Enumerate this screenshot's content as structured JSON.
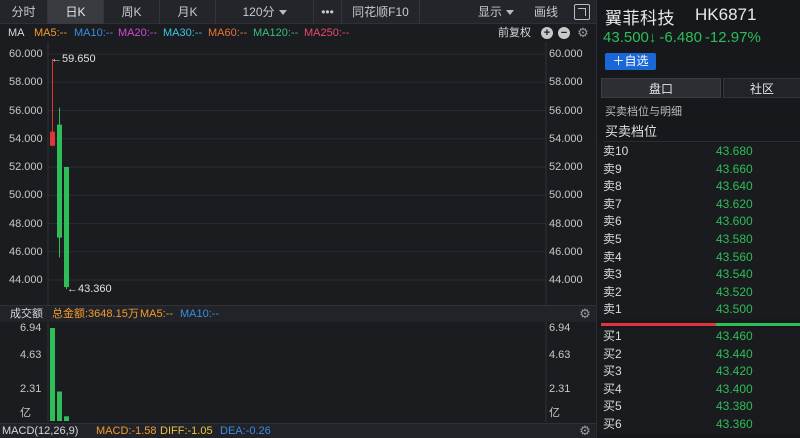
{
  "toolbar": {
    "tabs": [
      {
        "label": "分时"
      },
      {
        "label": "日K"
      },
      {
        "label": "周K"
      },
      {
        "label": "月K"
      },
      {
        "label": "120分"
      }
    ],
    "more_label": "•••",
    "f10_label": "同花顺F10",
    "display_label": "显示",
    "draw_label": "画线"
  },
  "indicators": {
    "ma_title": "MA",
    "ma5": "MA5:--",
    "ma10": "MA10:--",
    "ma20": "MA20:--",
    "ma30": "MA30:--",
    "ma60": "MA60:--",
    "ma120": "MA120:--",
    "ma250": "MA250:--",
    "adjust_label": "前复权",
    "colors": {
      "ma5": "#f39c2b",
      "ma10": "#3a8de0",
      "ma20": "#d04ad8",
      "ma30": "#3ec3e0",
      "ma60": "#e8743a",
      "ma120": "#3cbf7a",
      "ma250": "#e84a6a"
    }
  },
  "chart_data": [
    {
      "type": "candlestick",
      "title": "",
      "ylim": [
        43.0,
        60.5
      ],
      "yticks": [
        "60.000",
        "58.000",
        "56.000",
        "54.000",
        "52.000",
        "50.000",
        "48.000",
        "46.000",
        "44.000"
      ],
      "high_annotation": "←59.650",
      "low_annotation": "←43.360",
      "candles": [
        {
          "open": 53.5,
          "close": 54.5,
          "high": 59.65,
          "low": 53.5
        },
        {
          "open": 55.0,
          "close": 47.0,
          "high": 56.2,
          "low": 45.6
        },
        {
          "open": 52.0,
          "close": 43.5,
          "high": 52.0,
          "low": 43.36
        }
      ],
      "up_color": "#e0353c",
      "down_color": "#2ebd59"
    },
    {
      "type": "bar",
      "title": "",
      "header_label": "成交额",
      "total_label": "总金额:3648.15万",
      "ma5_label": "MA5:--",
      "ma10_label": "MA10:--",
      "yticks": [
        "6.94",
        "4.63",
        "2.31",
        "亿"
      ],
      "ylim": [
        0,
        6.94
      ],
      "values": [
        6.94,
        2.2,
        0.35
      ],
      "color": "#2ebd59"
    }
  ],
  "macd": {
    "title": "MACD(12,26,9)",
    "macd": "MACD:-1.58",
    "diff": "DIFF:-1.05",
    "dea": "DEA:-0.26"
  },
  "quote": {
    "name": "翼菲科技",
    "code": "HK6871",
    "price": "43.500",
    "arrow": "↓",
    "change": "-6.480",
    "change_pct": "-12.97%",
    "add_watch_label": "＋自选"
  },
  "tabs": {
    "pankou": "盘口",
    "shequ": "社区"
  },
  "orderbook": {
    "detail_label": "买卖档位与明细",
    "section_title": "买卖档位",
    "asks": [
      {
        "label": "卖10",
        "price": "43.680"
      },
      {
        "label": "卖9",
        "price": "43.660"
      },
      {
        "label": "卖8",
        "price": "43.640"
      },
      {
        "label": "卖7",
        "price": "43.620"
      },
      {
        "label": "卖6",
        "price": "43.600"
      },
      {
        "label": "卖5",
        "price": "43.580"
      },
      {
        "label": "卖4",
        "price": "43.560"
      },
      {
        "label": "卖3",
        "price": "43.540"
      },
      {
        "label": "卖2",
        "price": "43.520"
      },
      {
        "label": "卖1",
        "price": "43.500"
      }
    ],
    "bids": [
      {
        "label": "买1",
        "price": "43.460"
      },
      {
        "label": "买2",
        "price": "43.440"
      },
      {
        "label": "买3",
        "price": "43.420"
      },
      {
        "label": "买4",
        "price": "43.400"
      },
      {
        "label": "买5",
        "price": "43.380"
      },
      {
        "label": "买6",
        "price": "43.360"
      }
    ]
  }
}
